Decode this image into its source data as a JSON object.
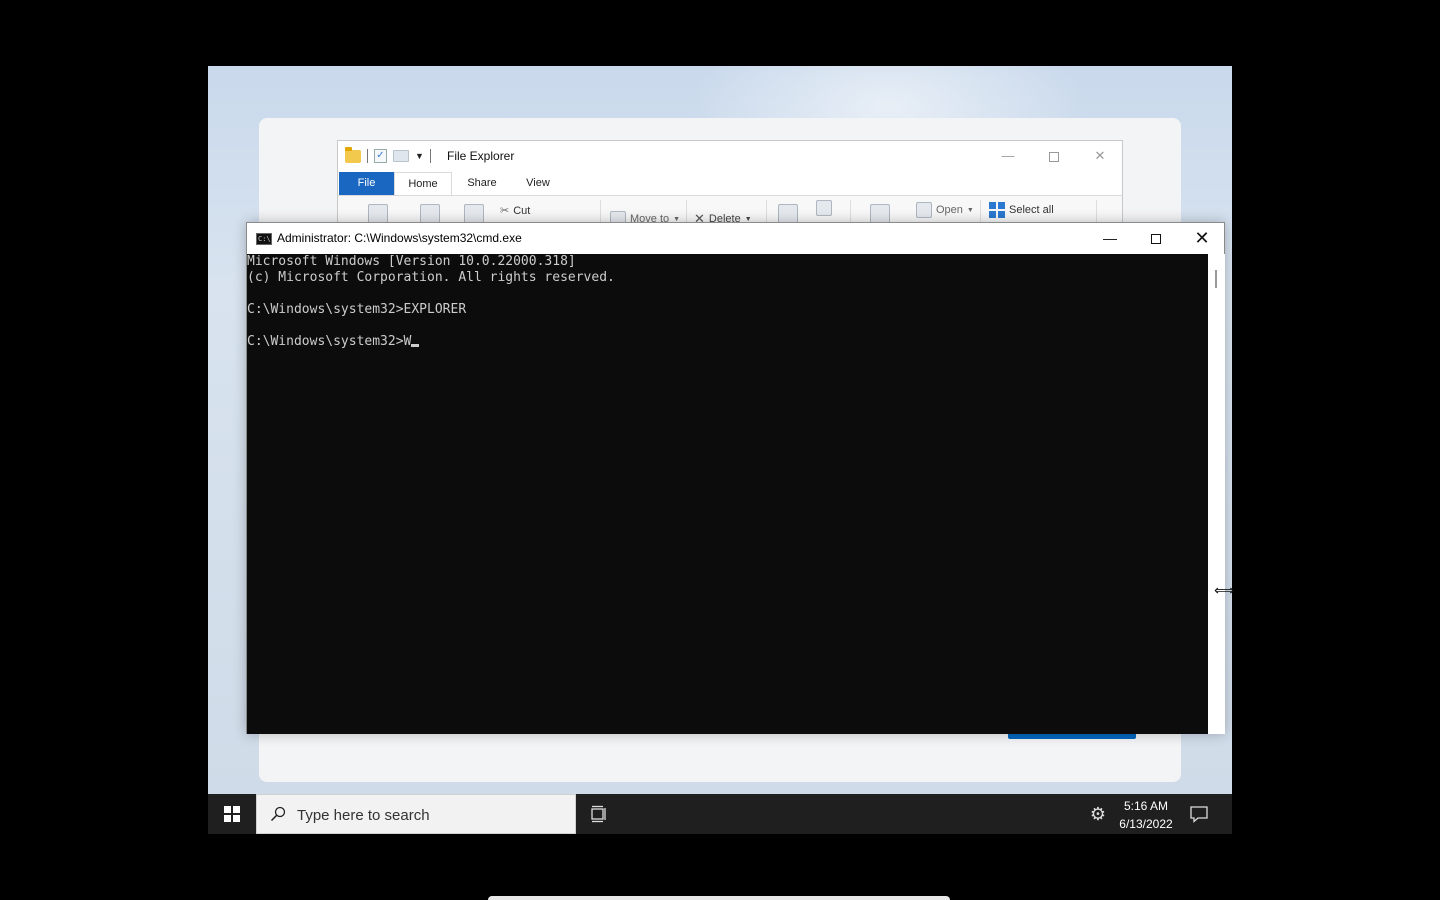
{
  "explorer": {
    "title": "File Explorer",
    "tabs": [
      "File",
      "Home",
      "Share",
      "View"
    ],
    "help_label": "?",
    "ribbon": {
      "cut": "Cut",
      "move_to": "Move to",
      "delete": "Delete",
      "open": "Open",
      "select_all": "Select all"
    }
  },
  "cmd": {
    "title": "Administrator: C:\\Windows\\system32\\cmd.exe",
    "icon_text": "C:\\",
    "lines": [
      "Microsoft Windows [Version 10.0.22000.318]",
      "(c) Microsoft Corporation. All rights reserved.",
      "",
      "C:\\Windows\\system32>EXPLORER",
      "",
      "C:\\Windows\\system32>W"
    ]
  },
  "taskbar": {
    "search_placeholder": "Type here to search",
    "time": "5:16 AM",
    "date": "6/13/2022"
  },
  "colors": {
    "accent": "#0067c0",
    "console_bg": "#0c0c0c",
    "console_fg": "#cccccc",
    "taskbar_bg": "#1f1f1f"
  }
}
